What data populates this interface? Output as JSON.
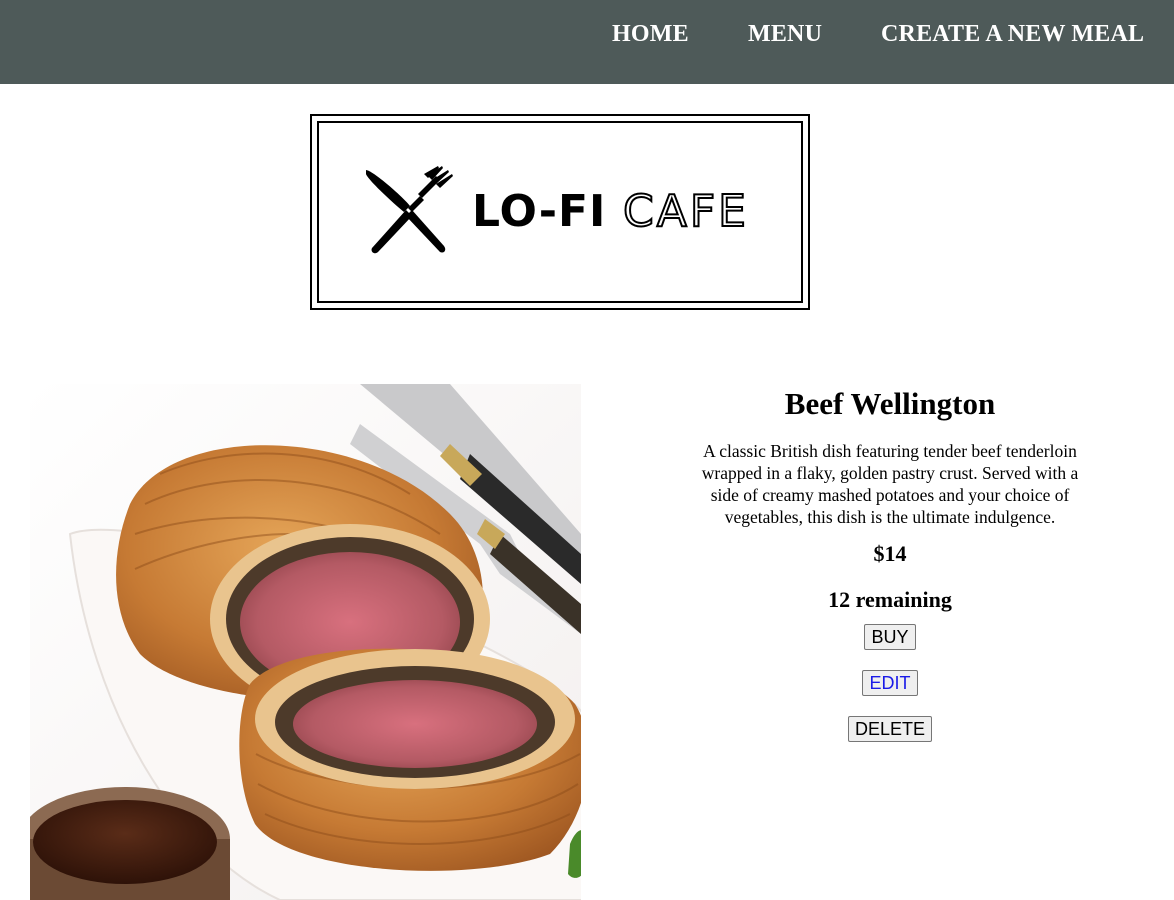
{
  "nav": {
    "home": "HOME",
    "menu": "MENU",
    "create": "CREATE A NEW MEAL",
    "background": "#4e5a59"
  },
  "logo": {
    "icon": "fork-knife-icon",
    "name_bold": "LO-FI",
    "name_outline": "CAFE"
  },
  "meal": {
    "image_alt": "Beef Wellington",
    "title": "Beef Wellington",
    "description": "A classic British dish featuring tender beef tenderloin wrapped in a flaky, golden pastry crust. Served with a side of creamy mashed potatoes and your choice of vegetables, this dish is the ultimate indulgence.",
    "price": "$14",
    "remaining": "12 remaining"
  },
  "actions": {
    "buy": "BUY",
    "edit": "EDIT",
    "delete": "DELETE"
  }
}
